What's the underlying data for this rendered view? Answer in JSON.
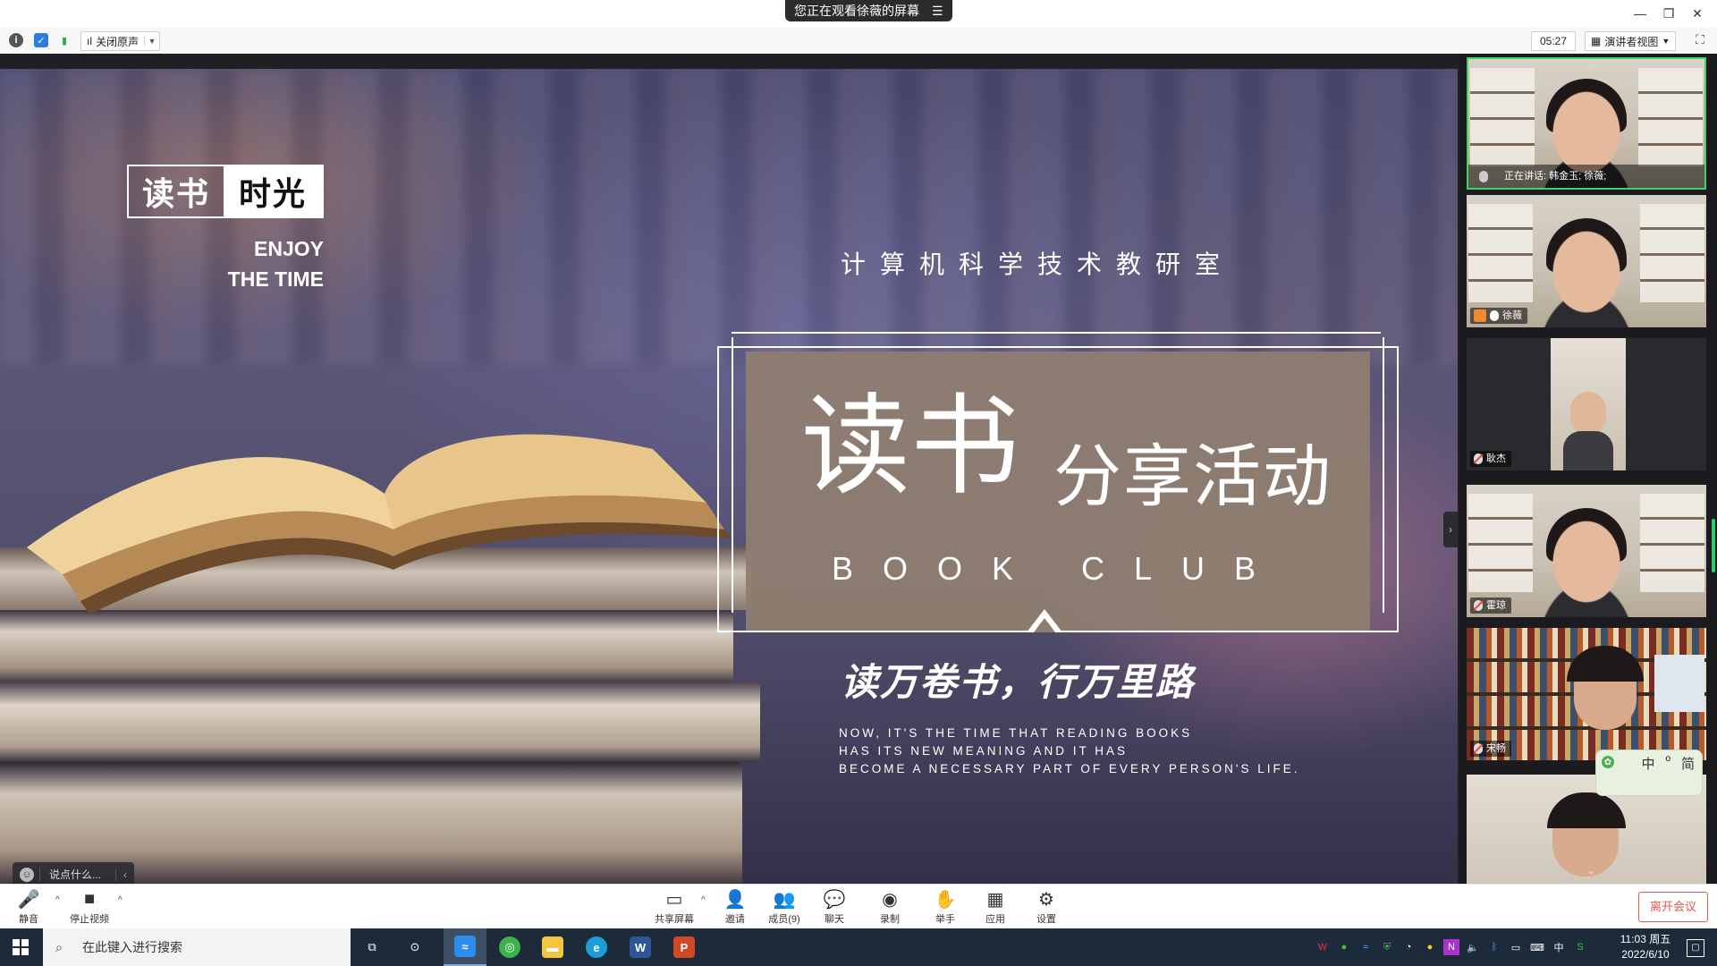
{
  "titlebar": {
    "share_banner": "您正在观看徐薇的屏幕",
    "controls": [
      "—",
      "❐",
      "✕"
    ]
  },
  "toolbar": {
    "audio_label": "关闭原声",
    "timer": "05:27",
    "view_label": "演讲者视图"
  },
  "slide": {
    "logo_left": "读书",
    "logo_right": "时光",
    "enjoy_line1": "ENJOY",
    "enjoy_line2": "THE TIME",
    "department": "计算机科学技术教研室",
    "title_big": "读书",
    "title_small": "分享活动",
    "book_club": "BOOK CLUB",
    "motto": "读万卷书，行万里路",
    "english_lines": [
      "NOW, IT'S THE TIME THAT READING BOOKS",
      "HAS ITS NEW MEANING AND IT HAS",
      "BECOME A NECESSARY PART OF EVERY PERSON'S LIFE."
    ],
    "comment_placeholder": "说点什么..."
  },
  "participants": {
    "speaking_label": "正在讲话: 韩金玉; 徐薇;",
    "tiles": [
      {
        "name": "徐薇"
      },
      {
        "name": "耿杰"
      },
      {
        "name": "霍琼"
      },
      {
        "name": "宋畅"
      }
    ],
    "ime": {
      "chars": [
        "中",
        "º",
        "简"
      ]
    }
  },
  "controls": {
    "mute": "静音",
    "stop_video": "停止视频",
    "share_screen": "共享屏幕",
    "invite": "邀请",
    "members": "成员(9)",
    "chat": "聊天",
    "record": "录制",
    "raise_hand": "举手",
    "apps": "应用",
    "settings": "设置",
    "leave": "离开会议"
  },
  "taskbar": {
    "search_placeholder": "在此键入进行搜索",
    "time": "11:03 周五",
    "date": "2022/6/10",
    "ime_indicator": "中"
  },
  "colors": {
    "slide_brown": "#8e7d70",
    "active_speaker": "#3bd46b",
    "leave": "#e05a4f"
  }
}
